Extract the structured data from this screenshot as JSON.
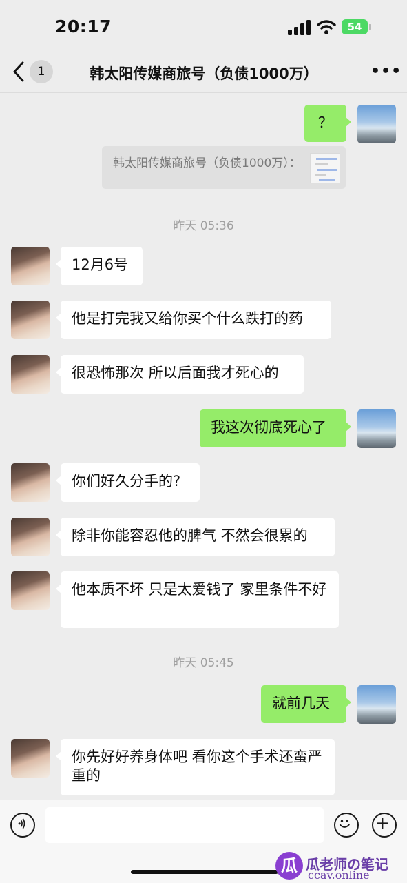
{
  "status_bar": {
    "time": "20:17",
    "battery": "54"
  },
  "nav": {
    "back_count": "1",
    "title": "韩太阳传媒商旅号（负债1000万）",
    "more": "•••"
  },
  "messages": [
    {
      "sender": "me",
      "text": "？"
    },
    {
      "quote": "韩太阳传媒商旅号（负债1000万）："
    },
    {
      "timestamp": "昨天 05:36"
    },
    {
      "sender": "them",
      "text": "12月6号"
    },
    {
      "sender": "them",
      "text": "他是打完我又给你买个什么跌打的药"
    },
    {
      "sender": "them",
      "text": "很恐怖那次 所以后面我才死心的"
    },
    {
      "sender": "me",
      "text": "我这次彻底死心了"
    },
    {
      "sender": "them",
      "text": "你们好久分手的?"
    },
    {
      "sender": "them",
      "text": "除非你能容忍他的脾气 不然会很累的"
    },
    {
      "sender": "them",
      "text": "他本质不坏 只是太爱钱了 家里条件不好"
    },
    {
      "timestamp": "昨天 05:45"
    },
    {
      "sender": "me",
      "text": "就前几天"
    },
    {
      "sender": "them",
      "text": "你先好好养身体吧 看你这个手术还蛮严重的"
    }
  ],
  "watermark": {
    "logo": "瓜",
    "line1": "瓜老师の笔记",
    "line2": "ccav.online"
  },
  "colors": {
    "my_bubble": "#95ec69",
    "their_bubble": "#ffffff",
    "background": "#ededed"
  },
  "icons": [
    "back-chevron-icon",
    "more-icon",
    "voice-icon",
    "emoji-icon",
    "plus-icon"
  ]
}
